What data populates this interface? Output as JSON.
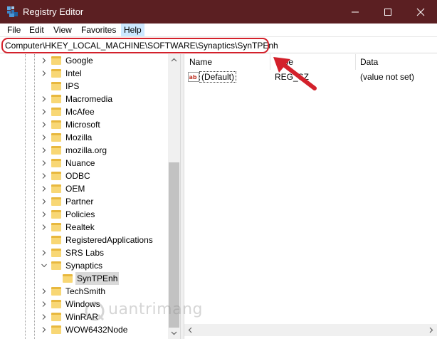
{
  "window": {
    "title": "Registry Editor",
    "title_bar_color": "#5b1f22",
    "minimize_icon": "minimize-icon",
    "maximize_icon": "maximize-icon",
    "close_icon": "close-icon"
  },
  "menu": {
    "items": [
      "File",
      "Edit",
      "View",
      "Favorites",
      "Help"
    ],
    "active": "Help"
  },
  "address": {
    "path": "Computer\\HKEY_LOCAL_MACHINE\\SOFTWARE\\Synaptics\\SynTPEnh"
  },
  "tree": {
    "items": [
      {
        "label": "Google",
        "expander": "collapsed"
      },
      {
        "label": "Intel",
        "expander": "collapsed"
      },
      {
        "label": "IPS",
        "expander": "none"
      },
      {
        "label": "Macromedia",
        "expander": "collapsed"
      },
      {
        "label": "McAfee",
        "expander": "collapsed"
      },
      {
        "label": "Microsoft",
        "expander": "collapsed"
      },
      {
        "label": "Mozilla",
        "expander": "collapsed"
      },
      {
        "label": "mozilla.org",
        "expander": "collapsed"
      },
      {
        "label": "Nuance",
        "expander": "collapsed"
      },
      {
        "label": "ODBC",
        "expander": "collapsed"
      },
      {
        "label": "OEM",
        "expander": "collapsed"
      },
      {
        "label": "Partner",
        "expander": "collapsed"
      },
      {
        "label": "Policies",
        "expander": "collapsed"
      },
      {
        "label": "Realtek",
        "expander": "collapsed"
      },
      {
        "label": "RegisteredApplications",
        "expander": "none"
      },
      {
        "label": "SRS Labs",
        "expander": "collapsed"
      },
      {
        "label": "Synaptics",
        "expander": "expanded"
      },
      {
        "label": "SynTPEnh",
        "expander": "none",
        "child": true,
        "selected": true
      },
      {
        "label": "TechSmith",
        "expander": "collapsed"
      },
      {
        "label": "Windows",
        "expander": "collapsed"
      },
      {
        "label": "WinRAR",
        "expander": "collapsed"
      },
      {
        "label": "WOW6432Node",
        "expander": "collapsed"
      }
    ]
  },
  "list": {
    "columns": [
      "Name",
      "Type",
      "Data"
    ],
    "rows": [
      {
        "name": "(Default)",
        "type": "REG_SZ",
        "data": "(value not set)",
        "icon": "string-value-icon"
      }
    ]
  },
  "watermark": {
    "text": "uantrimang"
  },
  "colors": {
    "selection": "#d9d9d9",
    "menu_active": "#cce8ff",
    "highlight_outline": "#d3212b",
    "arrow": "#d3212b"
  }
}
